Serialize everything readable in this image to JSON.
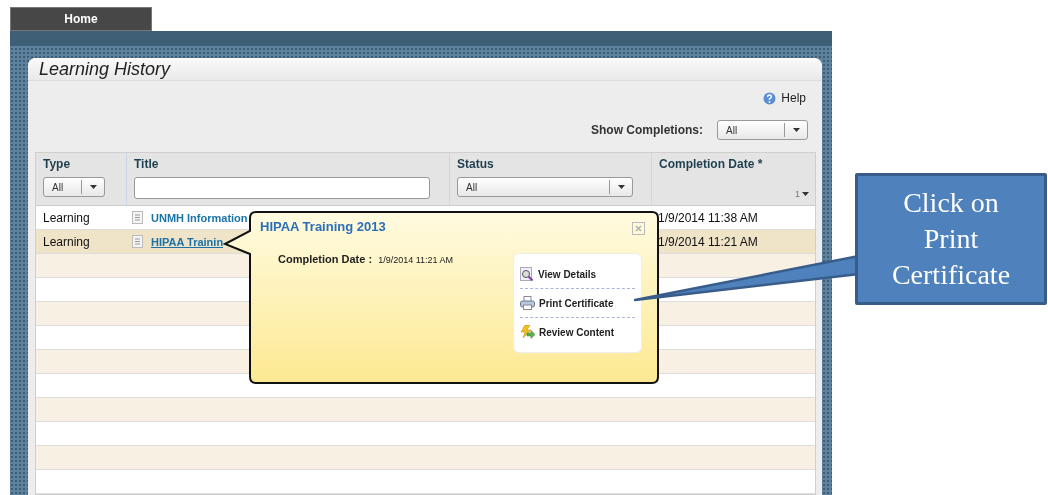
{
  "nav": {
    "tabs": [
      {
        "label": "Home",
        "selected": true
      }
    ]
  },
  "panel": {
    "title": "Learning History",
    "help": "Help",
    "filter": {
      "label": "Show Completions:",
      "value": "All"
    }
  },
  "table": {
    "columns": [
      {
        "label": "Type",
        "filter": {
          "kind": "select",
          "value": "All"
        }
      },
      {
        "label": "Title",
        "filter": {
          "kind": "text"
        }
      },
      {
        "label": "Status",
        "filter": {
          "kind": "select",
          "value": "All"
        }
      },
      {
        "label": "Completion Date *",
        "sort": "1"
      }
    ],
    "rows": [
      {
        "type": "Learning",
        "title": "UNMH Information",
        "completion_date": "1/9/2014 11:38 AM",
        "selected": false
      },
      {
        "type": "Learning",
        "title": "HIPAA Trainin",
        "completion_date": "1/9/2014 11:21 AM",
        "selected": true
      }
    ]
  },
  "popup": {
    "title": "HIPAA Training 2013",
    "field_label": "Completion Date :",
    "field_value": "1/9/2014 11:21 AM",
    "actions": [
      {
        "label": "View Details",
        "kind": "view"
      },
      {
        "label": "Print Certificate",
        "kind": "print"
      },
      {
        "label": "Review Content",
        "kind": "review"
      }
    ]
  },
  "callout": {
    "text": "Click on Print Certificate"
  }
}
